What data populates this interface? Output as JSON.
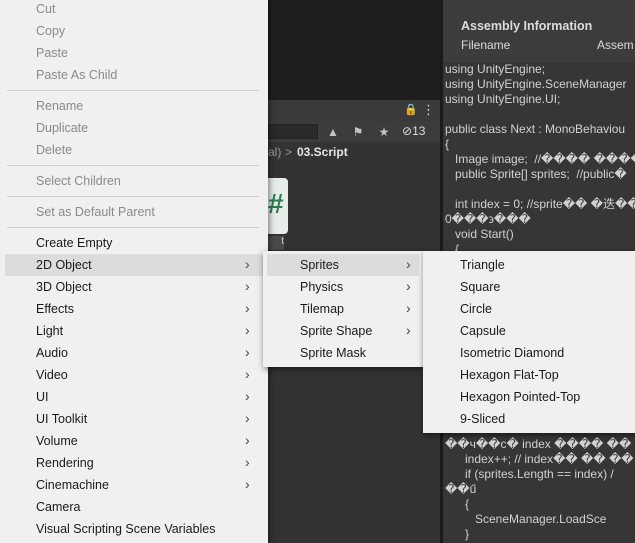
{
  "editor": {
    "hidden_count": "13",
    "breadcrumb_prefix": "al)",
    "breadcrumb_sep": ">",
    "breadcrumb_current": "03.Script",
    "script_icon_glyph": "#",
    "script_label": "t",
    "inspector": {
      "title": "Assembly Information",
      "col_filename": "Filename",
      "col_assembly": "Assem"
    },
    "code_lines": [
      "using UnityEngine;",
      "using UnityEngine.SceneManager",
      "using UnityEngine.UI;",
      "",
      "public class Next : MonoBehaviou",
      "{",
      "   Image image;  //���� ����",
      "   public Sprite[] sprites;  //public�",
      "",
      "   int index = 0; //sprite�� �迭��",
      "0���϶���",
      "   void Start()",
      "   {",
      "",
      "",
      "",
      "",
      "",
      "",
      "",
      "",
      "",
      "",
      "",
      "",
      "��ч��c� index ���� ��",
      "      index++; // index�� �� ��",
      "      if (sprites.Length == index) /",
      "��ű",
      "      {",
      "         SceneManager.LoadSce",
      "      }"
    ]
  },
  "context_menu": {
    "items": [
      {
        "label": "Cut",
        "disabled": true
      },
      {
        "label": "Copy",
        "disabled": true
      },
      {
        "label": "Paste",
        "disabled": true
      },
      {
        "label": "Paste As Child",
        "disabled": true
      },
      {
        "sep": true
      },
      {
        "label": "Rename",
        "disabled": true
      },
      {
        "label": "Duplicate",
        "disabled": true
      },
      {
        "label": "Delete",
        "disabled": true
      },
      {
        "sep": true
      },
      {
        "label": "Select Children",
        "disabled": true
      },
      {
        "sep": true
      },
      {
        "label": "Set as Default Parent",
        "disabled": true
      },
      {
        "sep": true
      },
      {
        "label": "Create Empty"
      },
      {
        "label": "2D Object",
        "submenu": true,
        "highlighted": true
      },
      {
        "label": "3D Object",
        "submenu": true
      },
      {
        "label": "Effects",
        "submenu": true
      },
      {
        "label": "Light",
        "submenu": true
      },
      {
        "label": "Audio",
        "submenu": true
      },
      {
        "label": "Video",
        "submenu": true
      },
      {
        "label": "UI",
        "submenu": true
      },
      {
        "label": "UI Toolkit",
        "submenu": true
      },
      {
        "label": "Volume",
        "submenu": true
      },
      {
        "label": "Rendering",
        "submenu": true
      },
      {
        "label": "Cinemachine",
        "submenu": true
      },
      {
        "label": "Camera"
      },
      {
        "label": "Visual Scripting Scene Variables"
      }
    ]
  },
  "submenu_2d": {
    "items": [
      {
        "label": "Sprites",
        "submenu": true,
        "highlighted": true
      },
      {
        "label": "Physics",
        "submenu": true
      },
      {
        "label": "Tilemap",
        "submenu": true
      },
      {
        "label": "Sprite Shape",
        "submenu": true
      },
      {
        "label": "Sprite Mask"
      }
    ]
  },
  "submenu_sprites": {
    "items": [
      {
        "label": "Triangle"
      },
      {
        "label": "Square"
      },
      {
        "label": "Circle"
      },
      {
        "label": "Capsule"
      },
      {
        "label": "Isometric Diamond"
      },
      {
        "label": "Hexagon Flat-Top"
      },
      {
        "label": "Hexagon Pointed-Top"
      },
      {
        "label": "9-Sliced"
      }
    ]
  },
  "icons": {
    "arrow": "›",
    "lock": "🔒",
    "kebab": "⋮"
  }
}
